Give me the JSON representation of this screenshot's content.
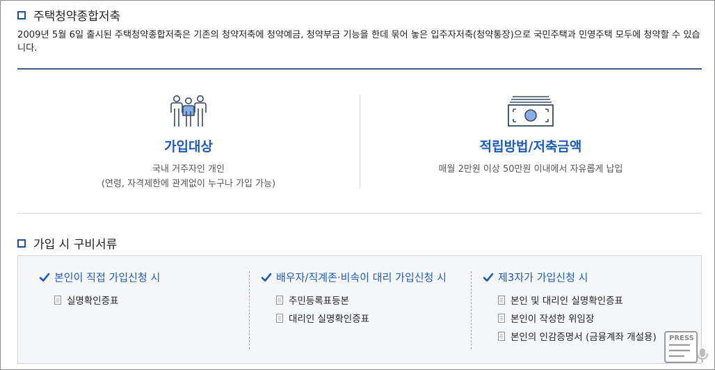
{
  "section1": {
    "title": "주택청약종합저축",
    "description": "2009년 5월 6일 출시된 주택청약종합저축은 기존의 청약저축에 청약예금, 청약부금 기능을 한데 묶어 놓은 입주자저축(청약통장)으로 국민주택과 민영주택 모두에 청약할 수 있습니다."
  },
  "features": [
    {
      "icon": "people-icon",
      "title": "가입대상",
      "desc_line1": "국내 거주자인 개인",
      "desc_line2": "(연령, 자격제한에 관계없이 누구나 가입 가능)"
    },
    {
      "icon": "banknote-icon",
      "title": "적립방법/저축금액",
      "desc_line1": "매월 2만원 이상 50만원 이내에서 자유롭게 납입"
    }
  ],
  "section2": {
    "title": "가입 시 구비서류",
    "columns": [
      {
        "heading": "본인이 직접 가입신청 시",
        "items": [
          "실명확인증표"
        ]
      },
      {
        "heading": "배우자/직계존·비속이 대리 가입신청 시",
        "items": [
          "주민등록표등본",
          "대리인 실명확인증표"
        ]
      },
      {
        "heading": "제3자가 가입신청 시",
        "items": [
          "본인 및 대리인 실명확인증표",
          "본인이 작성한 위임장",
          "본인의 인감증명서 (금융계좌 개설용)"
        ]
      }
    ]
  },
  "watermark": "PRESS",
  "colors": {
    "accent_blue": "#1c5bb5",
    "square_blue": "#1d4f9b",
    "rule_blue": "#3f5d88",
    "box_bg": "#f5f6f8"
  }
}
